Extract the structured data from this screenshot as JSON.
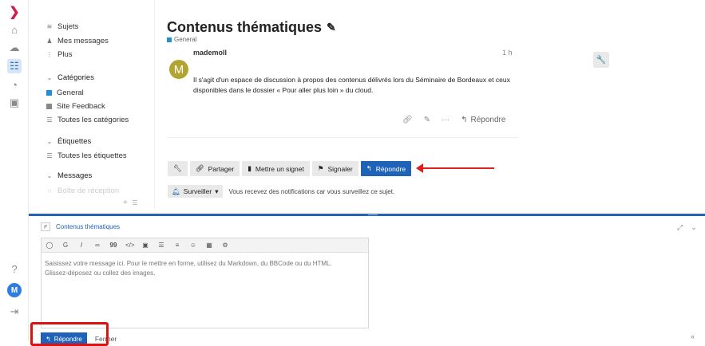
{
  "sidebar": {
    "topics": "Sujets",
    "my_messages": "Mes messages",
    "more": "Plus",
    "categories_heading": "Catégories",
    "cat_general": "General",
    "cat_feedback": "Site Feedback",
    "all_categories": "Toutes les catégories",
    "tags_heading": "Étiquettes",
    "all_tags": "Toutes les étiquettes",
    "messages_heading": "Messages",
    "inbox": "Boîte de réception",
    "footer_add": "+",
    "footer_icon": "☰"
  },
  "topic": {
    "title": "Contenus thématiques",
    "category": "General",
    "category_color": "#1e8fd8"
  },
  "post": {
    "avatar_letter": "M",
    "author": "mademoll",
    "time": "1 h",
    "body": "Il s'agit d'un espace de discussion à propos des contenus délivrés lors du Séminaire de Bordeaux et ceux disponibles dans le dossier « Pour aller plus loin » du cloud.",
    "reply_label": "Répondre"
  },
  "buttons": {
    "share": "Partager",
    "bookmark": "Mettre un signet",
    "flag": "Signaler",
    "reply": "Répondre"
  },
  "notifications": {
    "button": "Surveiller",
    "text": "Vous recevez des notifications car vous surveillez ce sujet."
  },
  "composer": {
    "reply_to": "Contenus thématiques",
    "placeholder_line1": "Saisissez votre message ici. Pour le mettre en forme, utilisez du Markdown, du BBCode ou du HTML.",
    "placeholder_line2": "Glissez-déposez ou collez des images.",
    "submit": "Répondre",
    "cancel": "Fermer"
  },
  "rail": {
    "avatar_letter": "M"
  },
  "colors": {
    "accent": "#1e63b8",
    "annotation_red": "#e01010"
  }
}
